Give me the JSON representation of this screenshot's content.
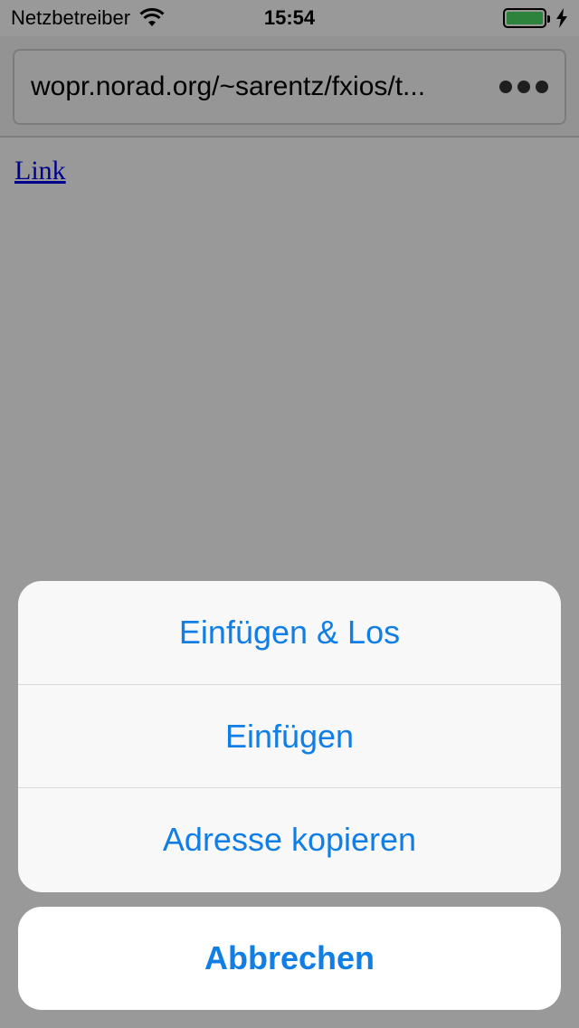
{
  "status_bar": {
    "carrier": "Netzbetreiber",
    "time": "15:54",
    "battery_level": 1.0,
    "charging": true
  },
  "toolbar": {
    "url": "wopr.norad.org/~sarentz/fxios/t..."
  },
  "page": {
    "link_text": "Link"
  },
  "action_sheet": {
    "items": [
      {
        "label": "Einfügen & Los"
      },
      {
        "label": "Einfügen"
      },
      {
        "label": "Adresse kopieren"
      }
    ],
    "cancel_label": "Abbrechen"
  },
  "colors": {
    "action_text": "#107ee5",
    "battery_fill": "#4cd964",
    "link": "#0000ee"
  }
}
